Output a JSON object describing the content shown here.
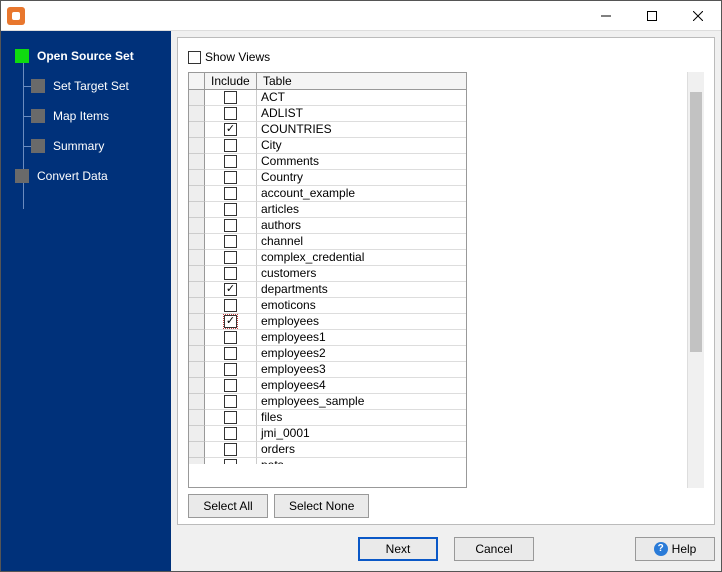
{
  "sidebar": {
    "items": [
      {
        "label": "Open Source Set",
        "active": true,
        "level": "root"
      },
      {
        "label": "Set Target Set",
        "active": false,
        "level": "child"
      },
      {
        "label": "Map Items",
        "active": false,
        "level": "child"
      },
      {
        "label": "Summary",
        "active": false,
        "level": "child"
      },
      {
        "label": "Convert Data",
        "active": false,
        "level": "root2"
      }
    ]
  },
  "main": {
    "show_views_label": "Show Views",
    "show_views_checked": false,
    "headers": {
      "include": "Include",
      "table": "Table"
    },
    "rows": [
      {
        "include": false,
        "table": "ACT"
      },
      {
        "include": false,
        "table": "ADLIST"
      },
      {
        "include": true,
        "table": "COUNTRIES"
      },
      {
        "include": false,
        "table": "City"
      },
      {
        "include": false,
        "table": "Comments"
      },
      {
        "include": false,
        "table": "Country"
      },
      {
        "include": false,
        "table": "account_example"
      },
      {
        "include": false,
        "table": "articles"
      },
      {
        "include": false,
        "table": "authors"
      },
      {
        "include": false,
        "table": "channel"
      },
      {
        "include": false,
        "table": "complex_credential"
      },
      {
        "include": false,
        "table": "customers"
      },
      {
        "include": true,
        "table": "departments"
      },
      {
        "include": false,
        "table": "emoticons"
      },
      {
        "include": true,
        "table": "employees",
        "focused": true
      },
      {
        "include": false,
        "table": "employees1"
      },
      {
        "include": false,
        "table": "employees2"
      },
      {
        "include": false,
        "table": "employees3"
      },
      {
        "include": false,
        "table": "employees4"
      },
      {
        "include": false,
        "table": "employees_sample"
      },
      {
        "include": false,
        "table": "files"
      },
      {
        "include": false,
        "table": "jmi_0001"
      },
      {
        "include": false,
        "table": "orders"
      },
      {
        "include": false,
        "table": "pets"
      }
    ],
    "select_all_label": "Select All",
    "select_none_label": "Select None"
  },
  "footer": {
    "next": "Next",
    "cancel": "Cancel",
    "help": "Help"
  }
}
